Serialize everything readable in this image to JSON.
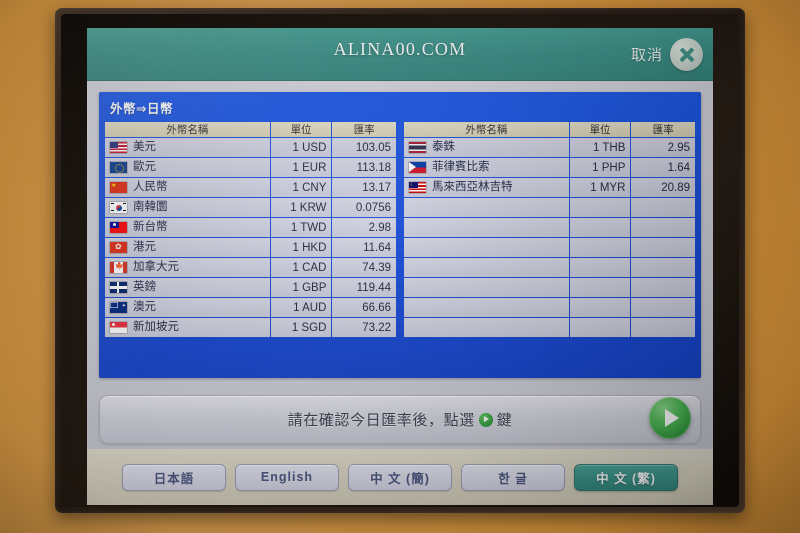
{
  "header": {
    "brand": "ALINA00.COM",
    "cancel_label": "取消",
    "close_icon": "close-x-icon",
    "bg_color": "#3a9189"
  },
  "panel": {
    "title": "外幣⇒日幣",
    "bg_color": "#1348d6",
    "columns": [
      "外幣名稱",
      "單位",
      "匯率"
    ],
    "left_table": [
      {
        "flag": "f-us",
        "flag_name": "flag-united-states",
        "name": "美元",
        "unit": "1 USD",
        "rate": "103.05"
      },
      {
        "flag": "f-eu",
        "flag_name": "flag-european-union",
        "name": "歐元",
        "unit": "1 EUR",
        "rate": "113.18"
      },
      {
        "flag": "f-cn",
        "flag_name": "flag-china",
        "name": "人民幣",
        "unit": "1 CNY",
        "rate": "13.17"
      },
      {
        "flag": "f-kr",
        "flag_name": "flag-south-korea",
        "name": "南韓圜",
        "unit": "1 KRW",
        "rate": "0.0756"
      },
      {
        "flag": "f-tw",
        "flag_name": "flag-taiwan",
        "name": "新台幣",
        "unit": "1 TWD",
        "rate": "2.98"
      },
      {
        "flag": "f-hk",
        "flag_name": "flag-hong-kong",
        "name": "港元",
        "unit": "1 HKD",
        "rate": "11.64"
      },
      {
        "flag": "f-ca",
        "flag_name": "flag-canada",
        "name": "加拿大元",
        "unit": "1 CAD",
        "rate": "74.39"
      },
      {
        "flag": "f-gb",
        "flag_name": "flag-united-kingdom",
        "name": "英鎊",
        "unit": "1 GBP",
        "rate": "119.44"
      },
      {
        "flag": "f-au",
        "flag_name": "flag-australia",
        "name": "澳元",
        "unit": "1 AUD",
        "rate": "66.66"
      },
      {
        "flag": "f-sg",
        "flag_name": "flag-singapore",
        "name": "新加坡元",
        "unit": "1 SGD",
        "rate": "73.22"
      }
    ],
    "right_table": [
      {
        "flag": "f-th",
        "flag_name": "flag-thailand",
        "name": "泰銖",
        "unit": "1 THB",
        "rate": "2.95"
      },
      {
        "flag": "f-ph",
        "flag_name": "flag-philippines",
        "name": "菲律賓比索",
        "unit": "1 PHP",
        "rate": "1.64"
      },
      {
        "flag": "f-my",
        "flag_name": "flag-malaysia",
        "name": "馬來西亞林吉特",
        "unit": "1 MYR",
        "rate": "20.89"
      },
      {
        "flag": "",
        "flag_name": "",
        "name": "",
        "unit": "",
        "rate": ""
      },
      {
        "flag": "",
        "flag_name": "",
        "name": "",
        "unit": "",
        "rate": ""
      },
      {
        "flag": "",
        "flag_name": "",
        "name": "",
        "unit": "",
        "rate": ""
      },
      {
        "flag": "",
        "flag_name": "",
        "name": "",
        "unit": "",
        "rate": ""
      },
      {
        "flag": "",
        "flag_name": "",
        "name": "",
        "unit": "",
        "rate": ""
      },
      {
        "flag": "",
        "flag_name": "",
        "name": "",
        "unit": "",
        "rate": ""
      },
      {
        "flag": "",
        "flag_name": "",
        "name": "",
        "unit": "",
        "rate": ""
      }
    ]
  },
  "instruction": {
    "text_before": "請在確認今日匯率後，點選",
    "text_after": "鍵",
    "play_icon": "play-icon",
    "next_button_icon": "play-next-button"
  },
  "languages": [
    {
      "label": "日本語",
      "active": false
    },
    {
      "label": "English",
      "active": false
    },
    {
      "label": "中 文 (簡)",
      "active": false
    },
    {
      "label": "한  글",
      "active": false
    },
    {
      "label": "中 文 (繁)",
      "active": true
    }
  ]
}
